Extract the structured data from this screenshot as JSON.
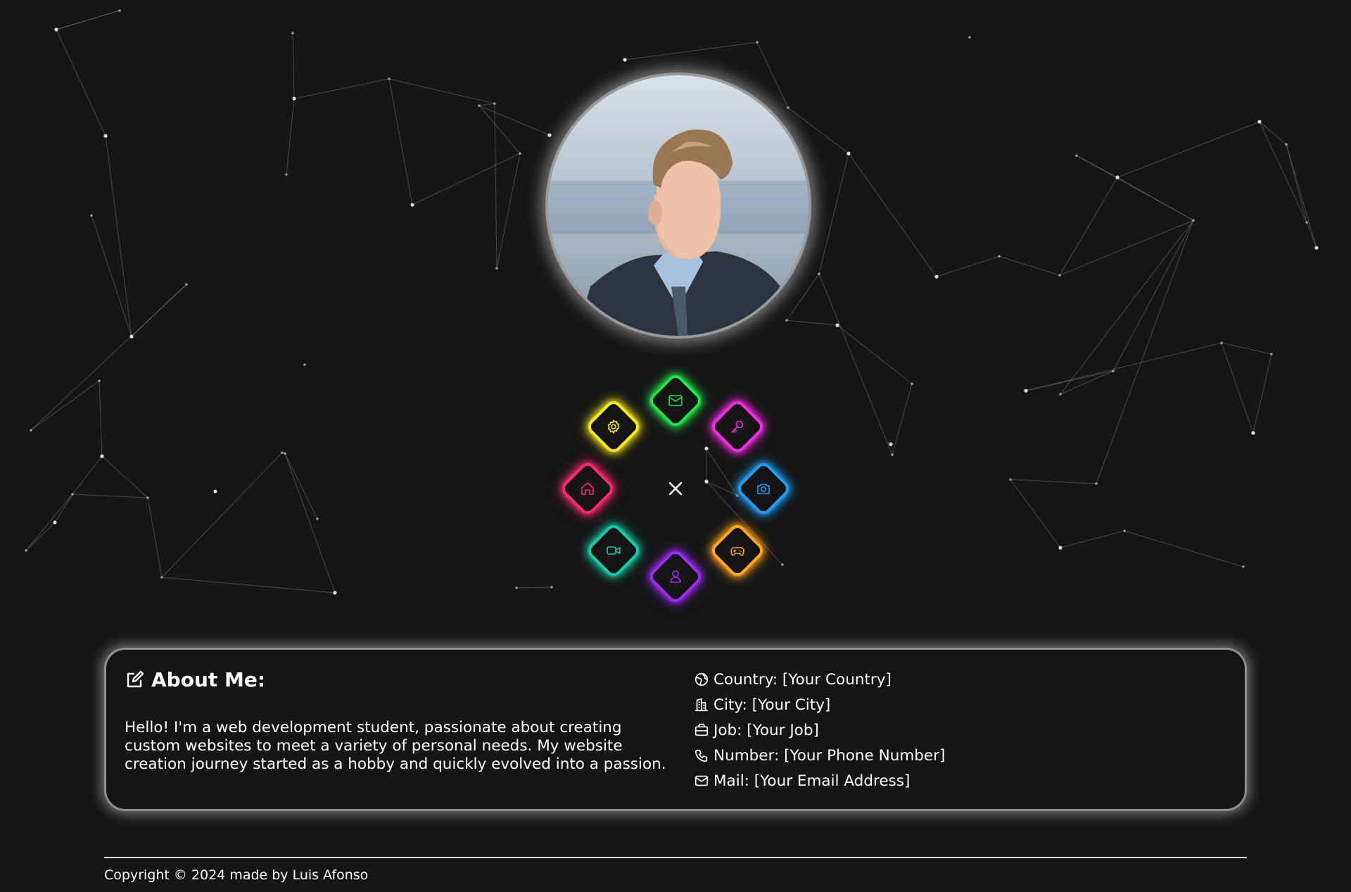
{
  "profile": {
    "avatar_alt": "Profile photo"
  },
  "menu": {
    "items": [
      {
        "name": "mail",
        "icon": "mail-icon",
        "color": "#20e34a"
      },
      {
        "name": "key",
        "icon": "key-icon",
        "color": "#f22ce1"
      },
      {
        "name": "camera",
        "icon": "camera-icon",
        "color": "#1e9df2"
      },
      {
        "name": "gamepad",
        "icon": "gamepad-icon",
        "color": "#ffa51f"
      },
      {
        "name": "profile",
        "icon": "user-icon",
        "color": "#9b2cf2"
      },
      {
        "name": "video",
        "icon": "video-icon",
        "color": "#16c9a6"
      },
      {
        "name": "home",
        "icon": "home-icon",
        "color": "#f72a6e"
      },
      {
        "name": "settings",
        "icon": "gear-icon",
        "color": "#f5e81d"
      }
    ],
    "toggle_icon": "close-icon"
  },
  "about": {
    "title": "About Me:",
    "text": "Hello! I'm a web development student, passionate about creating custom websites to meet a variety of personal needs. My website creation journey started as a hobby and quickly evolved into a passion.",
    "info": [
      {
        "icon": "globe-icon",
        "text": "Country: [Your Country]"
      },
      {
        "icon": "city-icon",
        "text": "City: [Your City]"
      },
      {
        "icon": "briefcase-icon",
        "text": "Job: [Your Job]"
      },
      {
        "icon": "phone-icon",
        "text": "Number: [Your Phone Number]"
      },
      {
        "icon": "mail-icon",
        "text": "Mail: [Your Email Address]"
      }
    ]
  },
  "footer": {
    "copyright": "Copyright © 2024 made by Luis Afonso"
  },
  "theme": {
    "background": "#151515",
    "foreground": "#ffffff"
  }
}
